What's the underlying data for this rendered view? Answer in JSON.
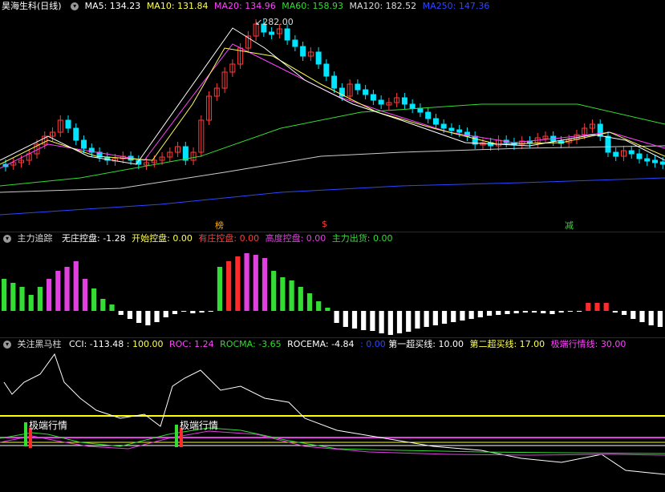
{
  "colors": {
    "up": "#ff3b3b",
    "down": "#00e5ff",
    "ma5": "#ffffff",
    "ma10": "#ffff55",
    "ma20": "#ff44ff",
    "ma60": "#33dd33",
    "ma120": "#cccccc",
    "ma250": "#2c46ff",
    "grid": "#8b0000",
    "magenta": "#e040e0",
    "green": "#33dd33",
    "red": "#ff2a2a",
    "white": "#ffffff",
    "yellow": "#ffff00"
  },
  "main": {
    "title": "昊海生科(日线)",
    "ma5": "MA5: 134.23",
    "ma10": "MA10: 131.84",
    "ma20": "MA20: 134.96",
    "ma60": "MA60: 158.93",
    "ma120": "MA120: 182.52",
    "ma250": "MA250: 147.36",
    "peak_label": "282.00",
    "markers": [
      "榜",
      "$",
      "减"
    ],
    "icons": [
      "circle-menu-icon"
    ]
  },
  "sub1": {
    "title": "主力追踪",
    "items": [
      {
        "label": "无庄控盘: -1.28"
      },
      {
        "label": "开始控盘: 0.00"
      },
      {
        "label": "有庄控盘: 0.00"
      },
      {
        "label": "高度控盘: 0.00"
      },
      {
        "label": "主力出货: 0.00"
      }
    ]
  },
  "sub2": {
    "title": "关注黑马柱",
    "items": [
      {
        "label": "CCI: -113.48"
      },
      {
        "label": ": 100.00"
      },
      {
        "label": "ROC: 1.24"
      },
      {
        "label": "ROCMA: -3.65"
      },
      {
        "label": "ROCEMA: -4.84"
      },
      {
        "label": ": 0.00"
      },
      {
        "label": "第一超买线: 10.00"
      },
      {
        "label": "第二超买线: 17.00"
      },
      {
        "label": "极端行情线: 30.00"
      }
    ],
    "annotations": [
      "极端行情",
      "极端行情"
    ]
  }
}
